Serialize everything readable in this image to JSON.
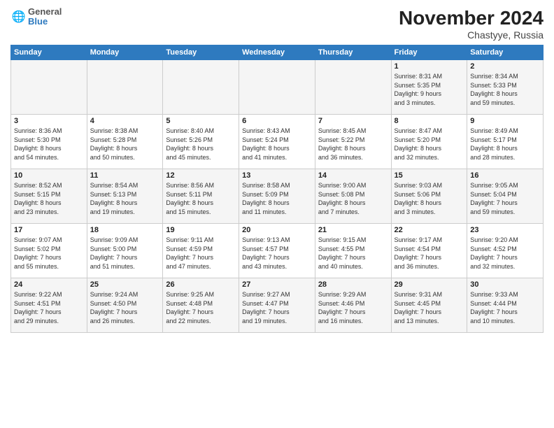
{
  "logo": {
    "line1": "General",
    "line2": "Blue"
  },
  "title": {
    "month_year": "November 2024",
    "location": "Chastyye, Russia"
  },
  "headers": [
    "Sunday",
    "Monday",
    "Tuesday",
    "Wednesday",
    "Thursday",
    "Friday",
    "Saturday"
  ],
  "weeks": [
    [
      {
        "day": "",
        "info": ""
      },
      {
        "day": "",
        "info": ""
      },
      {
        "day": "",
        "info": ""
      },
      {
        "day": "",
        "info": ""
      },
      {
        "day": "",
        "info": ""
      },
      {
        "day": "1",
        "info": "Sunrise: 8:31 AM\nSunset: 5:35 PM\nDaylight: 9 hours\nand 3 minutes."
      },
      {
        "day": "2",
        "info": "Sunrise: 8:34 AM\nSunset: 5:33 PM\nDaylight: 8 hours\nand 59 minutes."
      }
    ],
    [
      {
        "day": "3",
        "info": "Sunrise: 8:36 AM\nSunset: 5:30 PM\nDaylight: 8 hours\nand 54 minutes."
      },
      {
        "day": "4",
        "info": "Sunrise: 8:38 AM\nSunset: 5:28 PM\nDaylight: 8 hours\nand 50 minutes."
      },
      {
        "day": "5",
        "info": "Sunrise: 8:40 AM\nSunset: 5:26 PM\nDaylight: 8 hours\nand 45 minutes."
      },
      {
        "day": "6",
        "info": "Sunrise: 8:43 AM\nSunset: 5:24 PM\nDaylight: 8 hours\nand 41 minutes."
      },
      {
        "day": "7",
        "info": "Sunrise: 8:45 AM\nSunset: 5:22 PM\nDaylight: 8 hours\nand 36 minutes."
      },
      {
        "day": "8",
        "info": "Sunrise: 8:47 AM\nSunset: 5:20 PM\nDaylight: 8 hours\nand 32 minutes."
      },
      {
        "day": "9",
        "info": "Sunrise: 8:49 AM\nSunset: 5:17 PM\nDaylight: 8 hours\nand 28 minutes."
      }
    ],
    [
      {
        "day": "10",
        "info": "Sunrise: 8:52 AM\nSunset: 5:15 PM\nDaylight: 8 hours\nand 23 minutes."
      },
      {
        "day": "11",
        "info": "Sunrise: 8:54 AM\nSunset: 5:13 PM\nDaylight: 8 hours\nand 19 minutes."
      },
      {
        "day": "12",
        "info": "Sunrise: 8:56 AM\nSunset: 5:11 PM\nDaylight: 8 hours\nand 15 minutes."
      },
      {
        "day": "13",
        "info": "Sunrise: 8:58 AM\nSunset: 5:09 PM\nDaylight: 8 hours\nand 11 minutes."
      },
      {
        "day": "14",
        "info": "Sunrise: 9:00 AM\nSunset: 5:08 PM\nDaylight: 8 hours\nand 7 minutes."
      },
      {
        "day": "15",
        "info": "Sunrise: 9:03 AM\nSunset: 5:06 PM\nDaylight: 8 hours\nand 3 minutes."
      },
      {
        "day": "16",
        "info": "Sunrise: 9:05 AM\nSunset: 5:04 PM\nDaylight: 7 hours\nand 59 minutes."
      }
    ],
    [
      {
        "day": "17",
        "info": "Sunrise: 9:07 AM\nSunset: 5:02 PM\nDaylight: 7 hours\nand 55 minutes."
      },
      {
        "day": "18",
        "info": "Sunrise: 9:09 AM\nSunset: 5:00 PM\nDaylight: 7 hours\nand 51 minutes."
      },
      {
        "day": "19",
        "info": "Sunrise: 9:11 AM\nSunset: 4:59 PM\nDaylight: 7 hours\nand 47 minutes."
      },
      {
        "day": "20",
        "info": "Sunrise: 9:13 AM\nSunset: 4:57 PM\nDaylight: 7 hours\nand 43 minutes."
      },
      {
        "day": "21",
        "info": "Sunrise: 9:15 AM\nSunset: 4:55 PM\nDaylight: 7 hours\nand 40 minutes."
      },
      {
        "day": "22",
        "info": "Sunrise: 9:17 AM\nSunset: 4:54 PM\nDaylight: 7 hours\nand 36 minutes."
      },
      {
        "day": "23",
        "info": "Sunrise: 9:20 AM\nSunset: 4:52 PM\nDaylight: 7 hours\nand 32 minutes."
      }
    ],
    [
      {
        "day": "24",
        "info": "Sunrise: 9:22 AM\nSunset: 4:51 PM\nDaylight: 7 hours\nand 29 minutes."
      },
      {
        "day": "25",
        "info": "Sunrise: 9:24 AM\nSunset: 4:50 PM\nDaylight: 7 hours\nand 26 minutes."
      },
      {
        "day": "26",
        "info": "Sunrise: 9:25 AM\nSunset: 4:48 PM\nDaylight: 7 hours\nand 22 minutes."
      },
      {
        "day": "27",
        "info": "Sunrise: 9:27 AM\nSunset: 4:47 PM\nDaylight: 7 hours\nand 19 minutes."
      },
      {
        "day": "28",
        "info": "Sunrise: 9:29 AM\nSunset: 4:46 PM\nDaylight: 7 hours\nand 16 minutes."
      },
      {
        "day": "29",
        "info": "Sunrise: 9:31 AM\nSunset: 4:45 PM\nDaylight: 7 hours\nand 13 minutes."
      },
      {
        "day": "30",
        "info": "Sunrise: 9:33 AM\nSunset: 4:44 PM\nDaylight: 7 hours\nand 10 minutes."
      }
    ]
  ]
}
